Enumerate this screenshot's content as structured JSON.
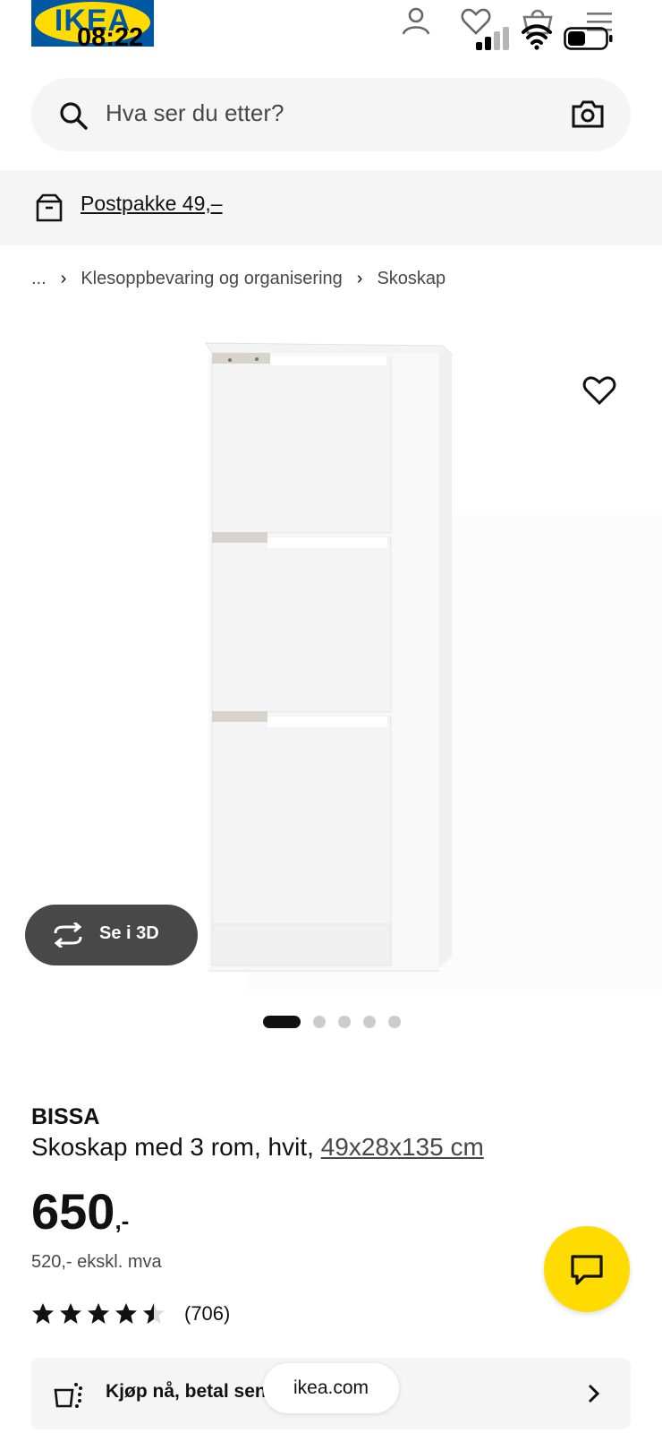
{
  "status_bar": {
    "time": "08:22"
  },
  "header": {
    "logo_text": "IKEA",
    "icons": [
      "user-icon",
      "heart-icon",
      "bag-icon",
      "menu-icon"
    ]
  },
  "search": {
    "placeholder": "Hva ser du etter?"
  },
  "shipping_banner": {
    "text": "Postpakke 49,–"
  },
  "breadcrumb": {
    "items": [
      "...",
      "Klesoppbevaring og organisering",
      "Skoskap"
    ]
  },
  "gallery": {
    "view_3d_label": "Se i 3D",
    "dots_total": 5,
    "active_dot": 1
  },
  "product": {
    "name": "BISSA",
    "description": "Skoskap med 3 rom, hvit, ",
    "dimensions": "49x28x135 cm",
    "price_int": "650",
    "price_dec": ",-",
    "price_ex_vat": "520,- ekskl. mva",
    "rating_stars": 4.5,
    "review_count": "(706)"
  },
  "klarna": {
    "text": "Kjøp nå, betal senere"
  },
  "browser": {
    "url": "ikea.com"
  },
  "colors": {
    "ikea_blue": "#0058a3",
    "ikea_yellow": "#ffdb00",
    "dark_button": "#484848",
    "light_bg": "#f5f5f5"
  }
}
